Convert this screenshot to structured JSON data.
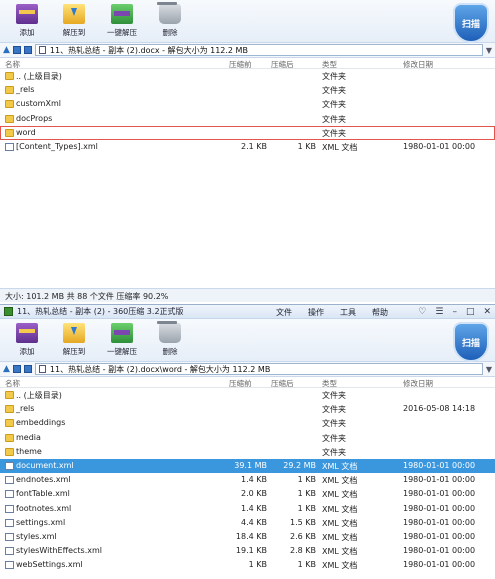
{
  "toolbar": {
    "add": "添加",
    "extract_to": "解压到",
    "one_click_extract": "一键解压",
    "delete": "删除",
    "scan": "扫描"
  },
  "columns": {
    "name": "名称",
    "size": "压缩前",
    "compressed": "压缩后",
    "type": "类型",
    "modified": "修改日期"
  },
  "panel1": {
    "address": "11、热轧总结 - 副本 (2).docx - 解包大小为 112.2 MB",
    "rows": [
      {
        "name": ".. (上级目录)",
        "size": "",
        "compressed": "",
        "type": "文件夹",
        "date": ""
      },
      {
        "name": "_rels",
        "size": "",
        "compressed": "",
        "type": "文件夹",
        "date": ""
      },
      {
        "name": "customXml",
        "size": "",
        "compressed": "",
        "type": "文件夹",
        "date": ""
      },
      {
        "name": "docProps",
        "size": "",
        "compressed": "",
        "type": "文件夹",
        "date": ""
      },
      {
        "name": "word",
        "size": "",
        "compressed": "",
        "type": "文件夹",
        "date": ""
      },
      {
        "name": "[Content_Types].xml",
        "size": "2.1 KB",
        "compressed": "1 KB",
        "type": "XML 文档",
        "date": "1980-01-01 00:00"
      }
    ],
    "status": "大小: 101.2 MB 共 88 个文件 压缩率 90.2%"
  },
  "panel2": {
    "window_title": "11、热轧总结 - 副本 (2) - 360压缩 3.2正式版",
    "menus": [
      "文件",
      "操作",
      "工具",
      "帮助"
    ],
    "address": "11、热轧总结 - 副本 (2).docx\\word - 解包大小为 112.2 MB",
    "rows": [
      {
        "name": ".. (上级目录)",
        "size": "",
        "compressed": "",
        "type": "文件夹",
        "date": ""
      },
      {
        "name": "_rels",
        "size": "",
        "compressed": "",
        "type": "文件夹",
        "date": "2016-05-08 14:18"
      },
      {
        "name": "embeddings",
        "size": "",
        "compressed": "",
        "type": "文件夹",
        "date": ""
      },
      {
        "name": "media",
        "size": "",
        "compressed": "",
        "type": "文件夹",
        "date": ""
      },
      {
        "name": "theme",
        "size": "",
        "compressed": "",
        "type": "文件夹",
        "date": ""
      },
      {
        "name": "document.xml",
        "size": "39.1 MB",
        "compressed": "29.2 MB",
        "type": "XML 文档",
        "date": "1980-01-01 00:00"
      },
      {
        "name": "endnotes.xml",
        "size": "1.4 KB",
        "compressed": "1 KB",
        "type": "XML 文档",
        "date": "1980-01-01 00:00"
      },
      {
        "name": "fontTable.xml",
        "size": "2.0 KB",
        "compressed": "1 KB",
        "type": "XML 文档",
        "date": "1980-01-01 00:00"
      },
      {
        "name": "footnotes.xml",
        "size": "1.4 KB",
        "compressed": "1 KB",
        "type": "XML 文档",
        "date": "1980-01-01 00:00"
      },
      {
        "name": "settings.xml",
        "size": "4.4 KB",
        "compressed": "1.5 KB",
        "type": "XML 文档",
        "date": "1980-01-01 00:00"
      },
      {
        "name": "styles.xml",
        "size": "18.4 KB",
        "compressed": "2.6 KB",
        "type": "XML 文档",
        "date": "1980-01-01 00:00"
      },
      {
        "name": "stylesWithEffects.xml",
        "size": "19.1 KB",
        "compressed": "2.8 KB",
        "type": "XML 文档",
        "date": "1980-01-01 00:00"
      },
      {
        "name": "webSettings.xml",
        "size": "1 KB",
        "compressed": "1 KB",
        "type": "XML 文档",
        "date": "1980-01-01 00:00"
      }
    ]
  },
  "colors": {
    "selection": "#3a96dd",
    "outline": "#e2554c",
    "folder": "#f3c94a"
  }
}
